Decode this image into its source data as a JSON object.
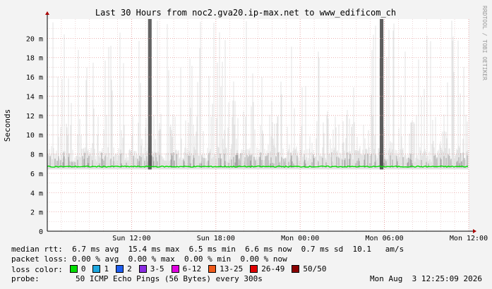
{
  "chart_data": {
    "type": "area",
    "title": "Last 30 Hours from noc2.gva20.ip-max.net to www_edificom_ch",
    "ylabel": "Seconds",
    "side_label": "RRDTOOL / TOBI OETIKER",
    "ylim": [
      0,
      22
    ],
    "yticks": [
      {
        "v": 0,
        "label": "0"
      },
      {
        "v": 2,
        "label": "2 m"
      },
      {
        "v": 4,
        "label": "4 m"
      },
      {
        "v": 6,
        "label": "6 m"
      },
      {
        "v": 8,
        "label": "8 m"
      },
      {
        "v": 10,
        "label": "10 m"
      },
      {
        "v": 12,
        "label": "12 m"
      },
      {
        "v": 14,
        "label": "14 m"
      },
      {
        "v": 16,
        "label": "16 m"
      },
      {
        "v": 18,
        "label": "18 m"
      },
      {
        "v": 20,
        "label": "20 m"
      }
    ],
    "xticks": [
      {
        "h": 9,
        "label": "Sun 12:00"
      },
      {
        "h": 15,
        "label": "Sun 18:00"
      },
      {
        "h": 21,
        "label": "Mon 00:00"
      },
      {
        "h": 27,
        "label": "Mon 06:00"
      },
      {
        "h": 33,
        "label": "Mon 12:00"
      }
    ],
    "xlim_hours": [
      3,
      33
    ],
    "median_ms": 6.7,
    "spikes": [
      {
        "h": 10.3,
        "ms": 22
      },
      {
        "h": 26.8,
        "ms": 22
      }
    ],
    "median_line_color": "#00dd00",
    "smoke_color": "#cccccc"
  },
  "stats": {
    "median_rtt": "median rtt:  6.7 ms avg  15.4 ms max  6.5 ms min  6.6 ms now  0.7 ms sd  10.1   am/s",
    "packet_loss": "packet loss: 0.00 % avg  0.00 % max  0.00 % min  0.00 % now",
    "loss_color_label": "loss color:",
    "probe_label": "probe:",
    "probe_text": "50 ICMP Echo Pings (56 Bytes) every 300s",
    "timestamp": "Mon Aug  3 12:25:09 2026"
  },
  "legend": [
    {
      "label": "0",
      "color": "#00dd00"
    },
    {
      "label": "1",
      "color": "#1ea8e0"
    },
    {
      "label": "2",
      "color": "#1f5ef0"
    },
    {
      "label": "3-5",
      "color": "#8a2be2"
    },
    {
      "label": "6-12",
      "color": "#e000e0"
    },
    {
      "label": "13-25",
      "color": "#f05a1a"
    },
    {
      "label": "26-49",
      "color": "#e00000"
    },
    {
      "label": "50/50",
      "color": "#8b0000"
    }
  ]
}
